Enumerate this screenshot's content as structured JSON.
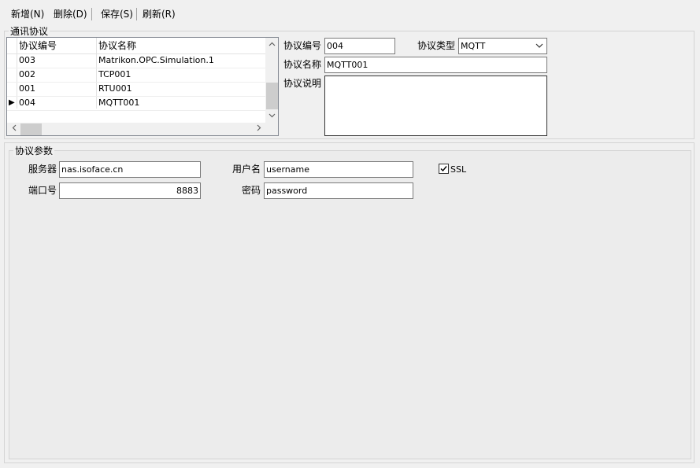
{
  "toolbar": {
    "add_label": "新增(N)",
    "delete_label": "删除(D)",
    "save_label": "保存(S)",
    "refresh_label": "刷新(R)"
  },
  "protocol_group": {
    "title": "通讯协议",
    "grid": {
      "columns": [
        "协议编号",
        "协议名称"
      ],
      "rows": [
        {
          "id": "003",
          "name": "Matrikon.OPC.Simulation.1"
        },
        {
          "id": "002",
          "name": "TCP001"
        },
        {
          "id": "001",
          "name": "RTU001"
        },
        {
          "id": "004",
          "name": "MQTT001"
        }
      ],
      "current_row_marker": "▶"
    },
    "form": {
      "id_label": "协议编号",
      "id_value": "004",
      "type_label": "协议类型",
      "type_value": "MQTT",
      "name_label": "协议名称",
      "name_value": "MQTT001",
      "desc_label": "协议说明",
      "desc_value": ""
    }
  },
  "params_group": {
    "title": "协议参数",
    "server_label": "服务器",
    "server_value": "nas.isoface.cn",
    "port_label": "端口号",
    "port_value": "8883",
    "username_label": "用户名",
    "username_value": "username",
    "password_label": "密码",
    "password_value": "password",
    "ssl_label": "SSL",
    "ssl_checked": true
  }
}
